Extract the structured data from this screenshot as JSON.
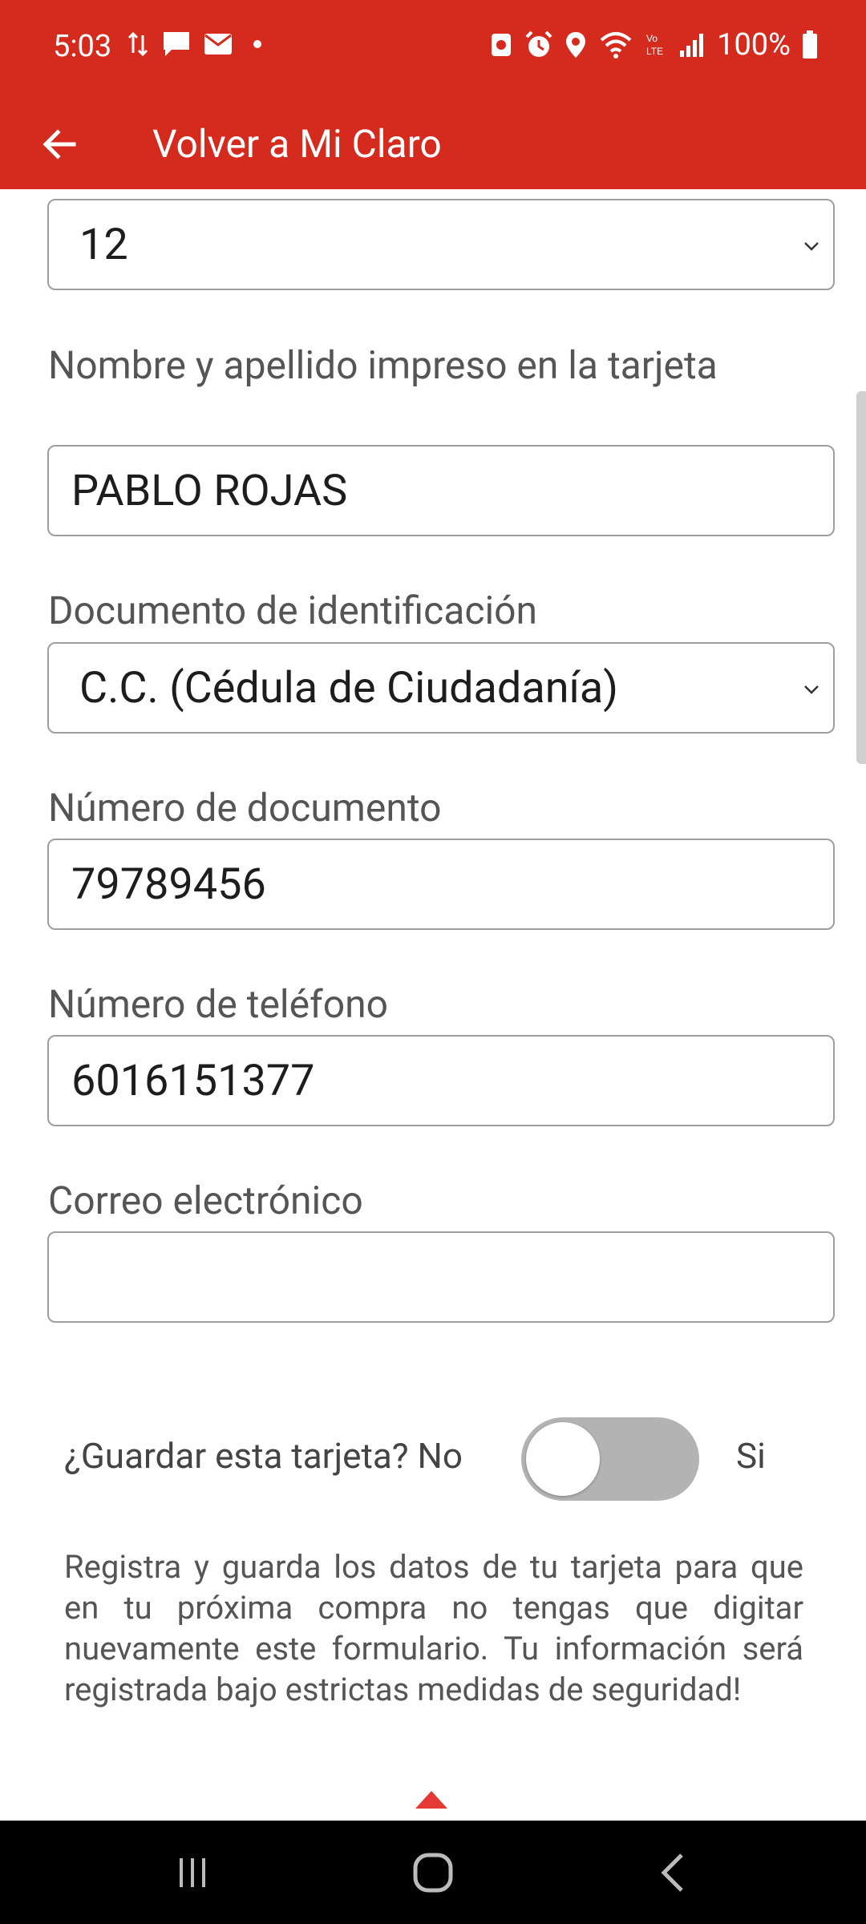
{
  "status": {
    "time": "5:03",
    "battery": "100%",
    "icons_left": [
      "data-transfer-icon",
      "chat-icon",
      "mail-icon",
      "dot-icon"
    ],
    "icons_right": [
      "recycle-icon",
      "alarm-icon",
      "location-icon",
      "wifi-icon",
      "volte-icon",
      "signal-icon",
      "battery-icon"
    ]
  },
  "appbar": {
    "title": "Volver a Mi Claro",
    "back_icon": "arrow-left-icon"
  },
  "form": {
    "month_value": "12",
    "name_label": "Nombre y apellido impreso en la tarjeta",
    "name_value": "PABLO ROJAS",
    "doc_type_label": "Documento de identificación",
    "doc_type_value": "C.C. (Cédula de Ciudadanía)",
    "doc_number_label": "Número de documento",
    "doc_number_value": "79789456",
    "phone_label": "Número de teléfono",
    "phone_value": "6016151377",
    "email_label": "Correo electrónico",
    "email_value": ""
  },
  "save_card": {
    "question": "¿Guardar esta tarjeta? No",
    "yes_label": "Si",
    "toggle_on": false,
    "disclaimer": "Registra y guarda los datos de tu tarjeta para que en tu próxima compra no tengas que digitar nuevamente este formulario. Tu información será registrada bajo estrictas medidas de seguridad!"
  },
  "colors": {
    "brand_red": "#d52b1e",
    "toggle_off": "#b3b3b3"
  },
  "navbar": {
    "buttons": [
      "recent-apps-icon",
      "home-icon",
      "back-icon"
    ]
  }
}
